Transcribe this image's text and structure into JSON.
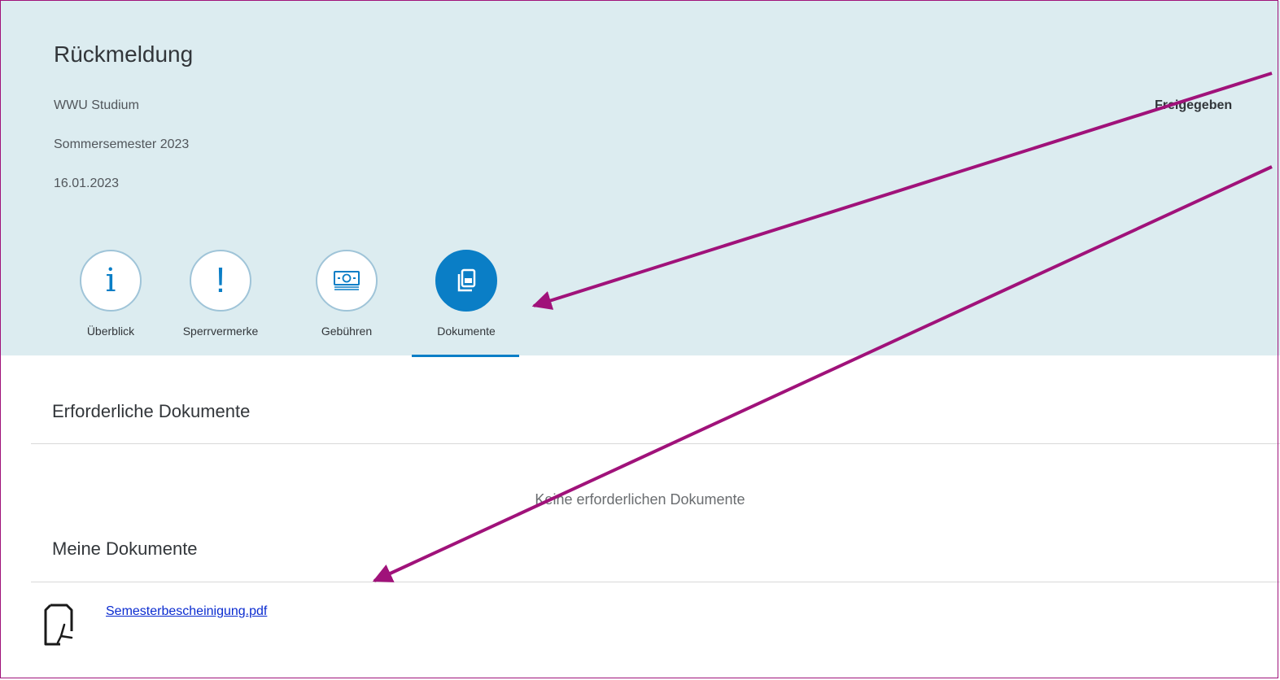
{
  "header": {
    "title": "Rückmeldung",
    "program": "WWU Studium",
    "semester": "Sommersemester 2023",
    "date": "16.01.2023",
    "status": "Freigegeben"
  },
  "tabs": [
    {
      "label": "Überblick",
      "icon": "info-icon",
      "active": false
    },
    {
      "label": "Sperrvermerke",
      "icon": "exclamation-icon",
      "active": false
    },
    {
      "label": "Gebühren",
      "icon": "money-icon",
      "active": false
    },
    {
      "label": "Dokumente",
      "icon": "documents-icon",
      "active": true
    }
  ],
  "required_documents": {
    "title": "Erforderliche Dokumente",
    "empty_message": "Keine erforderlichen Dokumente"
  },
  "my_documents": {
    "title": "Meine Dokumente",
    "files": [
      {
        "name": "Semesterbescheinigung.pdf",
        "icon": "pdf-file-icon"
      }
    ]
  },
  "colors": {
    "header_bg": "#dcecf0",
    "accent": "#0a7ec6",
    "link": "#0a2bd0",
    "annotation": "#a0127a"
  }
}
